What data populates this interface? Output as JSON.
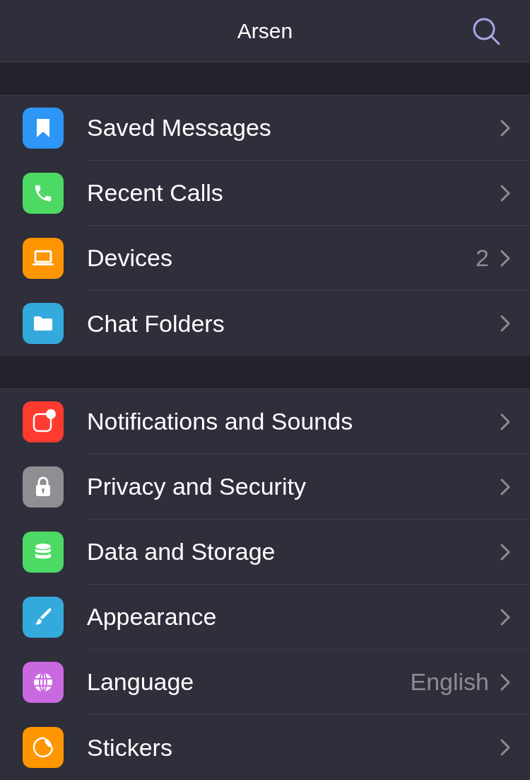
{
  "header": {
    "title": "Arsen"
  },
  "groups": [
    {
      "items": [
        {
          "label": "Saved Messages",
          "kind": "bookmark",
          "color": "#2d96f6"
        },
        {
          "label": "Recent Calls",
          "kind": "phone",
          "color": "#4cd964"
        },
        {
          "label": "Devices",
          "kind": "laptop",
          "color": "#ff9500",
          "value": "2"
        },
        {
          "label": "Chat Folders",
          "kind": "folder",
          "color": "#34aadc"
        }
      ]
    },
    {
      "items": [
        {
          "label": "Notifications and Sounds",
          "kind": "notification",
          "color": "#ff3b30"
        },
        {
          "label": "Privacy and Security",
          "kind": "lock",
          "color": "#8e8e93"
        },
        {
          "label": "Data and Storage",
          "kind": "database",
          "color": "#4cd964"
        },
        {
          "label": "Appearance",
          "kind": "brush",
          "color": "#34aadc"
        },
        {
          "label": "Language",
          "kind": "globe",
          "color": "#c969e0",
          "value": "English"
        },
        {
          "label": "Stickers",
          "kind": "sticker",
          "color": "#ff9500"
        }
      ]
    }
  ]
}
